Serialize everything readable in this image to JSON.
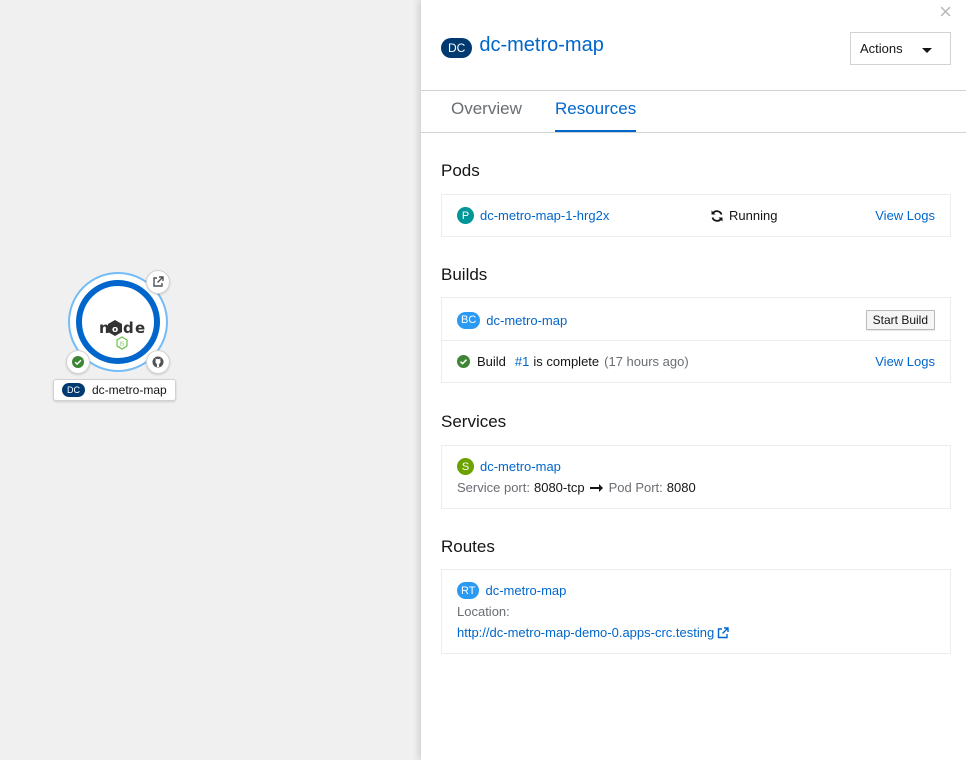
{
  "canvas": {
    "node": {
      "badge": "DC",
      "name": "dc-metro-map",
      "logo_text": "node"
    }
  },
  "panel": {
    "close_label": "×",
    "header": {
      "badge": "DC",
      "title": "dc-metro-map",
      "actions_label": "Actions"
    },
    "tabs": [
      {
        "label": "Overview",
        "active": false
      },
      {
        "label": "Resources",
        "active": true
      }
    ],
    "pods": {
      "title": "Pods",
      "items": [
        {
          "badge": "P",
          "name": "dc-metro-map-1-hrg2x",
          "status": "Running",
          "action": "View Logs"
        }
      ]
    },
    "builds": {
      "title": "Builds",
      "config": {
        "badge": "BC",
        "name": "dc-metro-map",
        "action": "Start Build"
      },
      "latest": {
        "prefix": "Build",
        "number": "#1",
        "status": "is complete",
        "time": "(17 hours ago)",
        "action": "View Logs"
      }
    },
    "services": {
      "title": "Services",
      "items": [
        {
          "badge": "S",
          "name": "dc-metro-map",
          "service_port_label": "Service port:",
          "service_port": "8080-tcp",
          "pod_port_label": "Pod Port:",
          "pod_port": "8080"
        }
      ]
    },
    "routes": {
      "title": "Routes",
      "items": [
        {
          "badge": "RT",
          "name": "dc-metro-map",
          "location_label": "Location:",
          "url": "http://dc-metro-map-demo-0.apps-crc.testing"
        }
      ]
    }
  },
  "colors": {
    "accent": "#0066cc",
    "dc_badge": "#003a70",
    "pod_badge": "#009596",
    "svc_badge": "#6ca100",
    "success": "#3e8635"
  }
}
